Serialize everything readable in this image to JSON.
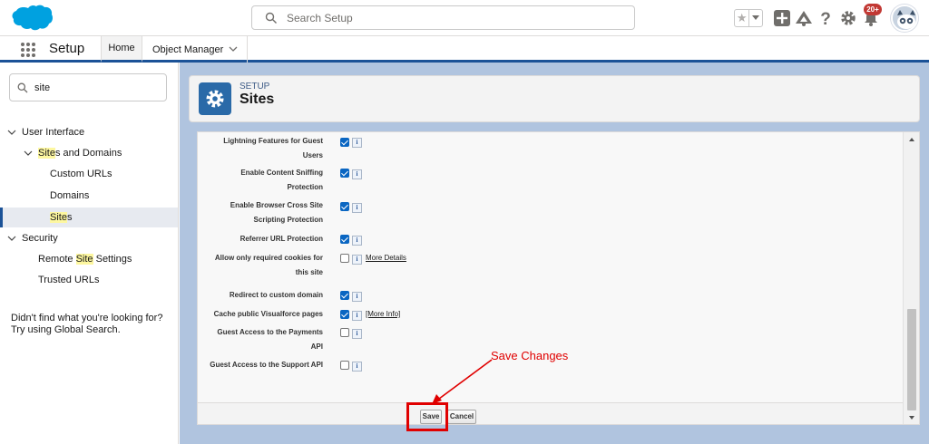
{
  "header": {
    "search_placeholder": "Search Setup",
    "notification_badge": "20+",
    "brand_color": "#00a1e0",
    "icons": [
      "star-icon",
      "chevron-down-icon",
      "plus-icon",
      "trailhead-icon",
      "help-icon",
      "gear-icon",
      "bell-icon",
      "avatar-icon"
    ]
  },
  "nav": {
    "app_name": "Setup",
    "tabs": [
      {
        "label": "Home",
        "active": true
      },
      {
        "label": "Object Manager",
        "active": false
      }
    ]
  },
  "sidebar": {
    "quick_find_value": "site",
    "items": [
      {
        "label": "User Interface",
        "prefix": "",
        "highlight": "",
        "suffix": ""
      },
      {
        "label": "",
        "prefix": "",
        "highlight": "Site",
        "suffix": "s and Domains"
      },
      {
        "label": "Custom URLs"
      },
      {
        "label": "Domains"
      },
      {
        "label": "",
        "prefix": "",
        "highlight": "Site",
        "suffix": "s"
      },
      {
        "label": "Security"
      },
      {
        "label": "",
        "prefix": "Remote ",
        "highlight": "Site",
        "suffix": " Settings"
      },
      {
        "label": "Trusted URLs"
      }
    ],
    "not_found_text": "Didn't find what you're looking for? Try using Global Search."
  },
  "page_header": {
    "eyebrow": "SETUP",
    "title": "Sites"
  },
  "fields": [
    {
      "label": "Lightning Features for Guest Users",
      "checked": true,
      "link": ""
    },
    {
      "label": "Enable Content Sniffing Protection",
      "checked": true,
      "link": ""
    },
    {
      "label": "Enable Browser Cross Site Scripting Protection",
      "checked": true,
      "link": ""
    },
    {
      "label": "Referrer URL Protection",
      "checked": true,
      "link": ""
    },
    {
      "label": "Allow only required cookies for this site",
      "checked": false,
      "link": "More Details"
    },
    {
      "label": "Redirect to custom domain",
      "checked": true,
      "link": ""
    },
    {
      "label": "Cache public Visualforce pages",
      "checked": true,
      "link": "[More Info]"
    },
    {
      "label": "Guest Access to the Payments API",
      "checked": false,
      "link": ""
    },
    {
      "label": "Guest Access to the Support API",
      "checked": false,
      "link": ""
    }
  ],
  "info_glyph": "i",
  "buttons": {
    "save": "Save",
    "cancel": "Cancel"
  },
  "annotation": {
    "text": "Save Changes",
    "color": "#e00000"
  }
}
